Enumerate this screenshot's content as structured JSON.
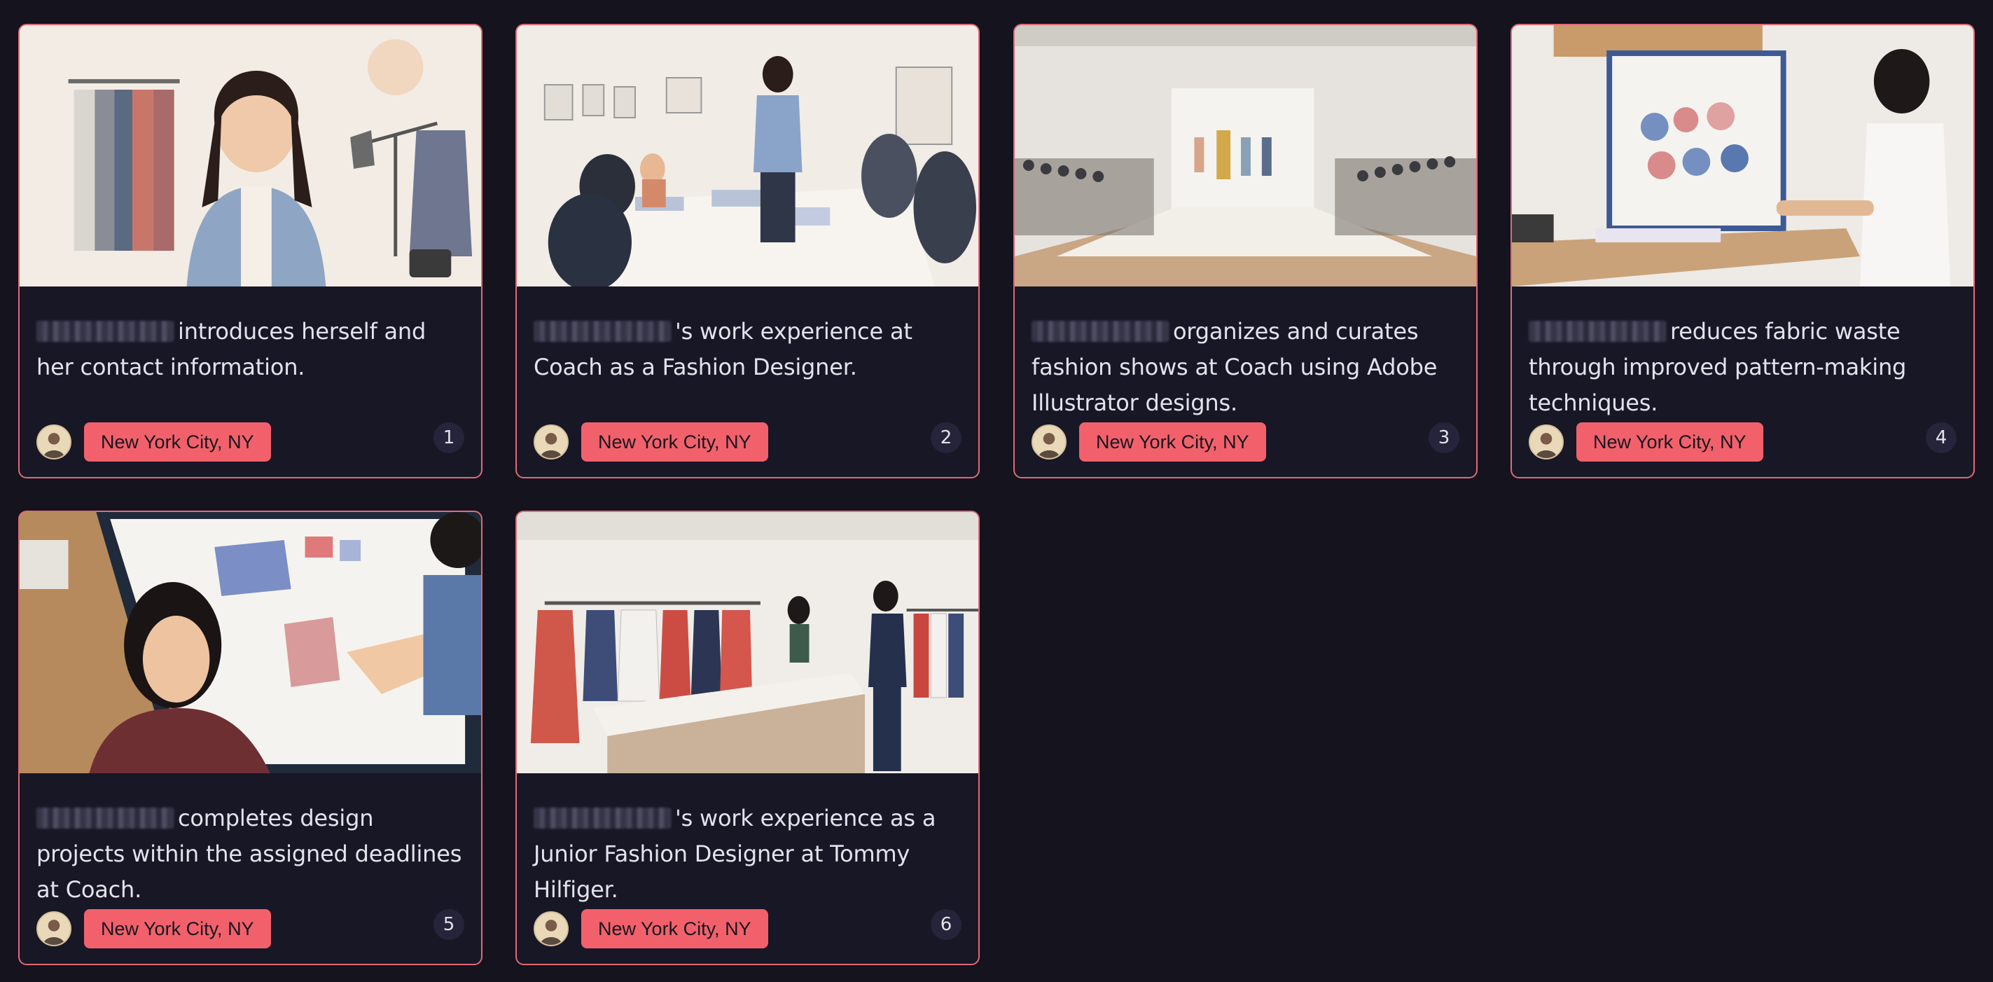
{
  "cards": [
    {
      "caption": "introduces herself and her contact information.",
      "location": "New York City, NY",
      "number": "1",
      "image": "designer-portrait-illustration"
    },
    {
      "caption": "'s work experience at Coach as a Fashion Designer.",
      "location": "New York City, NY",
      "number": "2",
      "image": "team-meeting-illustration"
    },
    {
      "caption": "organizes and curates fashion shows at Coach using Adobe Illustrator designs.",
      "location": "New York City, NY",
      "number": "3",
      "image": "runway-show-illustration"
    },
    {
      "caption": "reduces fabric waste through improved pattern-making techniques.",
      "location": "New York City, NY",
      "number": "4",
      "image": "pattern-making-illustration"
    },
    {
      "caption": "completes design projects within the assigned deadlines at Coach.",
      "location": "New York City, NY",
      "number": "5",
      "image": "design-desk-illustration"
    },
    {
      "caption": "'s work experience as a Junior Fashion Designer at Tommy Hilfiger.",
      "location": "New York City, NY",
      "number": "6",
      "image": "showroom-illustration"
    }
  ],
  "colors": {
    "background": "#14131e",
    "card": "#181726",
    "card_border": "#e06a76",
    "badge": "#f2616b",
    "text": "#e4e3ec"
  }
}
